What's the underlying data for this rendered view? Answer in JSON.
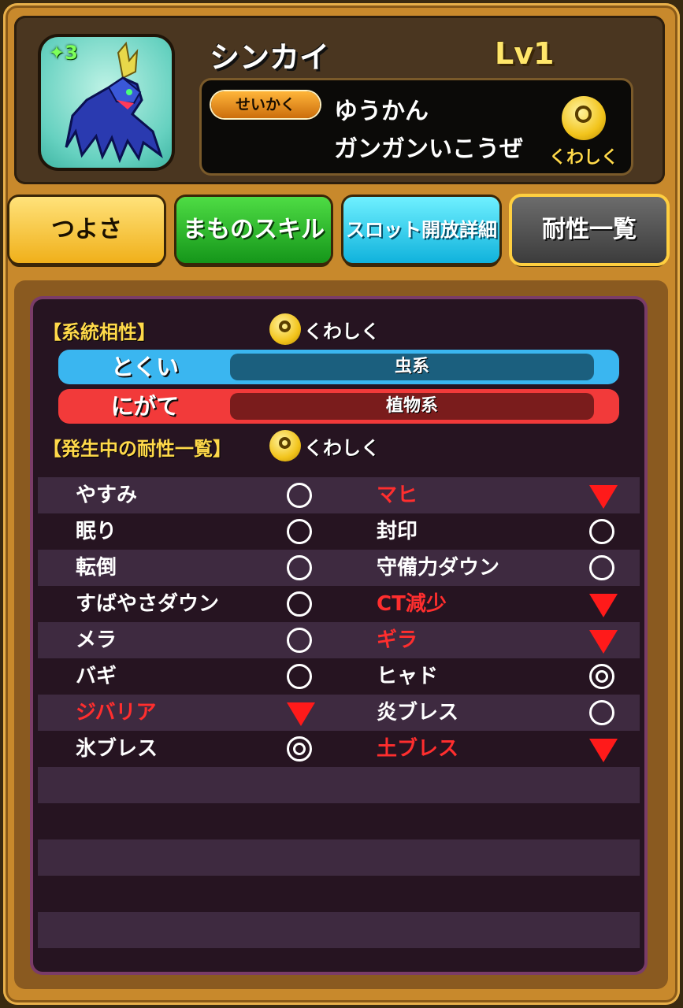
{
  "monster": {
    "rank": "✦3",
    "name": "シンカイ",
    "level": "Lv1",
    "personality_tag": "せいかく",
    "personality": "ゆうかん",
    "personality_desc": "ガンガンいこうぜ",
    "detail_label": "くわしく"
  },
  "tabs": [
    "つよさ",
    "まものスキル",
    "スロット開放詳細",
    "耐性一覧"
  ],
  "affinity": {
    "title": "【系統相性】",
    "detail_label": "くわしく",
    "good_label": "とくい",
    "good_value": "虫系",
    "bad_label": "にがて",
    "bad_value": "植物系"
  },
  "resistances": {
    "title": "【発生中の耐性一覧】",
    "detail_label": "くわしく",
    "rows": [
      {
        "left": {
          "name": "やすみ",
          "mark": "circle",
          "weak": false
        },
        "right": {
          "name": "マヒ",
          "mark": "down",
          "weak": true
        }
      },
      {
        "left": {
          "name": "眠り",
          "mark": "circle",
          "weak": false
        },
        "right": {
          "name": "封印",
          "mark": "circle",
          "weak": false
        }
      },
      {
        "left": {
          "name": "転倒",
          "mark": "circle",
          "weak": false
        },
        "right": {
          "name": "守備力ダウン",
          "mark": "circle",
          "weak": false
        }
      },
      {
        "left": {
          "name": "すばやさダウン",
          "mark": "circle",
          "weak": false
        },
        "right": {
          "name": "CT減少",
          "mark": "down",
          "weak": true
        }
      },
      {
        "left": {
          "name": "メラ",
          "mark": "circle",
          "weak": false
        },
        "right": {
          "name": "ギラ",
          "mark": "down",
          "weak": true
        }
      },
      {
        "left": {
          "name": "バギ",
          "mark": "circle",
          "weak": false
        },
        "right": {
          "name": "ヒャド",
          "mark": "double",
          "weak": false
        }
      },
      {
        "left": {
          "name": "ジバリア",
          "mark": "down",
          "weak": true
        },
        "right": {
          "name": "炎ブレス",
          "mark": "circle",
          "weak": false
        }
      },
      {
        "left": {
          "name": "氷ブレス",
          "mark": "double",
          "weak": false
        },
        "right": {
          "name": "土ブレス",
          "mark": "down",
          "weak": true
        }
      }
    ]
  }
}
